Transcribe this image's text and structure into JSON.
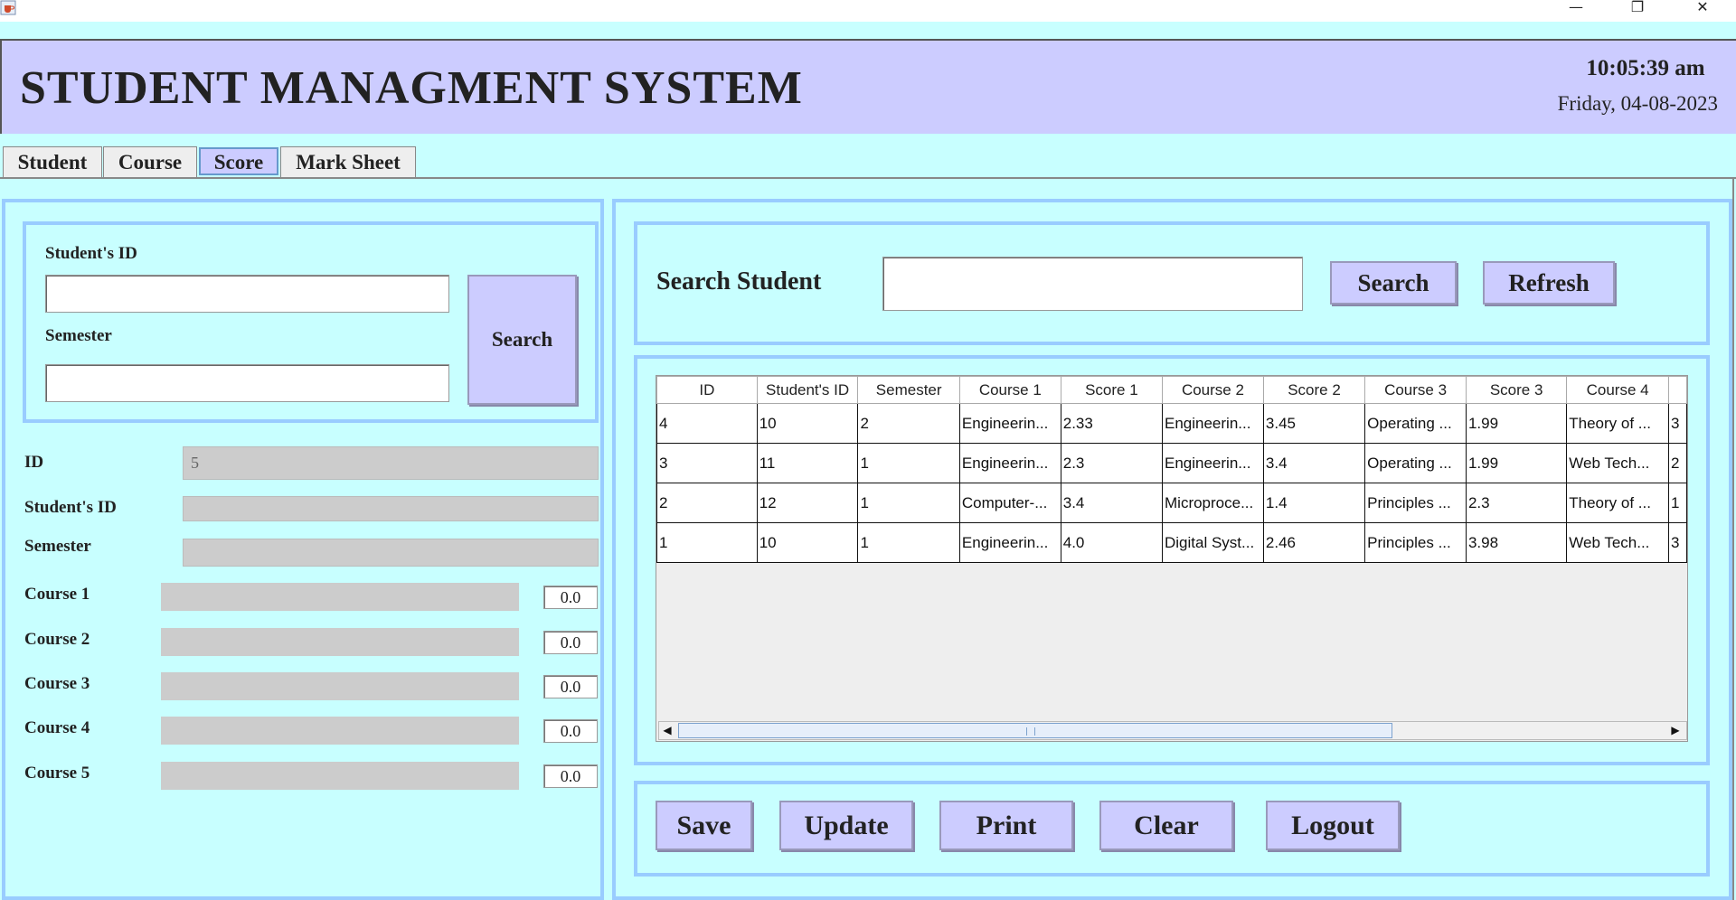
{
  "window": {
    "minimize_glyph": "—",
    "restore_glyph": "❐",
    "close_glyph": "✕",
    "app_icon": "java-cup-icon"
  },
  "header": {
    "title": "STUDENT MANAGMENT SYSTEM",
    "time": "10:05:39 am",
    "date": "Friday, 04-08-2023"
  },
  "tabs": [
    {
      "label": "Student"
    },
    {
      "label": "Course"
    },
    {
      "label": "Score",
      "active": true
    },
    {
      "label": "Mark Sheet"
    }
  ],
  "search_box": {
    "student_id_label": "Student's ID",
    "semester_label": "Semester",
    "student_id_value": "",
    "semester_value": "",
    "search_label": "Search"
  },
  "form": {
    "id_label": "ID",
    "id_value": "5",
    "student_id_label": "Student's ID",
    "student_id_value": "",
    "semester_label": "Semester",
    "semester_value": "",
    "courses": [
      {
        "label": "Course 1",
        "value": "",
        "score": "0.0"
      },
      {
        "label": "Course 2",
        "value": "",
        "score": "0.0"
      },
      {
        "label": "Course 3",
        "value": "",
        "score": "0.0"
      },
      {
        "label": "Course 4",
        "value": "",
        "score": "0.0"
      },
      {
        "label": "Course 5",
        "value": "",
        "score": "0.0"
      }
    ]
  },
  "search_student": {
    "label": "Search Student",
    "value": "",
    "search_label": "Search",
    "refresh_label": "Refresh"
  },
  "table": {
    "columns": [
      "ID",
      "Student's ID",
      "Semester",
      "Course 1",
      "Score 1",
      "Course 2",
      "Score 2",
      "Course 3",
      "Score 3",
      "Course 4",
      ""
    ],
    "rows": [
      [
        "4",
        "10",
        "2",
        "Engineerin...",
        "2.33",
        "Engineerin...",
        "3.45",
        "Operating ...",
        "1.99",
        "Theory of ...",
        "3"
      ],
      [
        "3",
        "11",
        "1",
        "Engineerin...",
        "2.3",
        "Engineerin...",
        "3.4",
        "Operating ...",
        "1.99",
        "Web Tech...",
        "2"
      ],
      [
        "2",
        "12",
        "1",
        "Computer-...",
        "3.4",
        "Microproce...",
        "1.4",
        "Principles ...",
        "2.3",
        "Theory of ...",
        "1"
      ],
      [
        "1",
        "10",
        "1",
        "Engineerin...",
        "4.0",
        "Digital Syst...",
        "2.46",
        "Principles ...",
        "3.98",
        "Web Tech...",
        "3"
      ]
    ]
  },
  "actions": {
    "save": "Save",
    "update": "Update",
    "print": "Print",
    "clear": "Clear",
    "logout": "Logout"
  }
}
